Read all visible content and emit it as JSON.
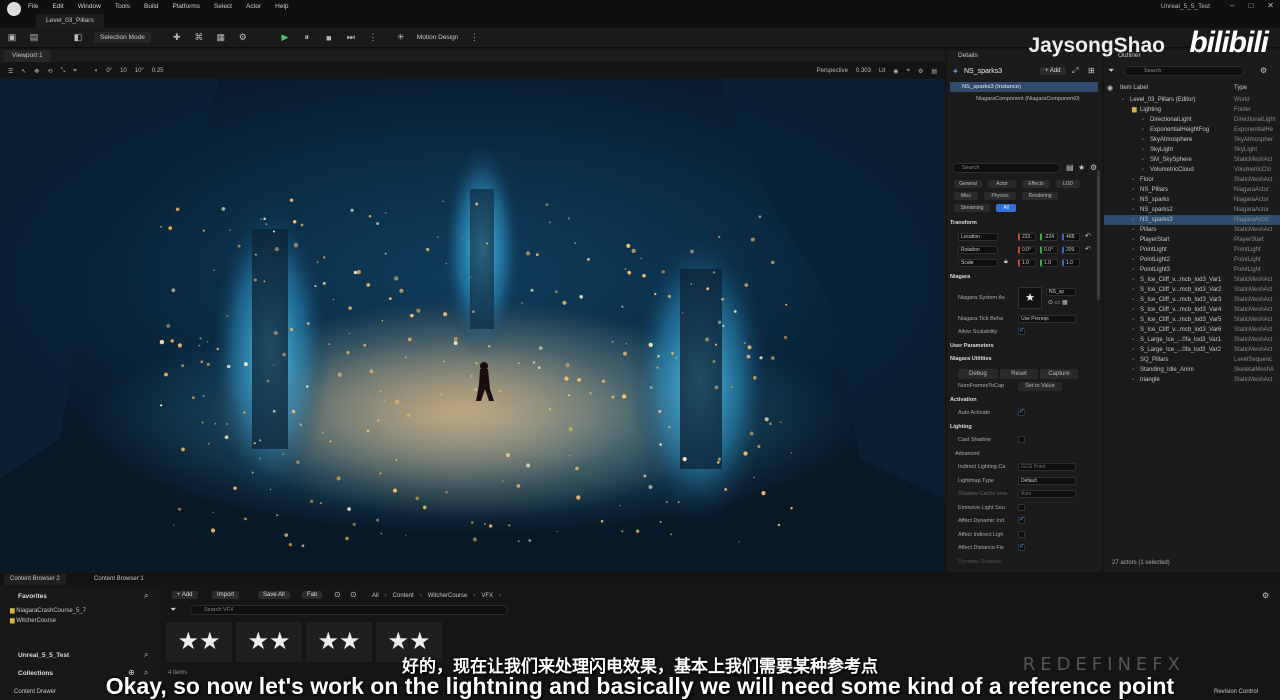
{
  "menu": [
    "File",
    "Edit",
    "Window",
    "Tools",
    "Build",
    "Platforms",
    "Select",
    "Actor",
    "Help"
  ],
  "level_tab": "Level_03_Pillars",
  "project_name": "Unreal_5_5_Test",
  "window_controls": [
    "–",
    "□",
    "✕"
  ],
  "toolbar": {
    "selection_mode": "Selection Mode",
    "motion_design": "Motion Design"
  },
  "viewport": {
    "tab": "Viewport 1",
    "toolbar_values": [
      "0°",
      "10",
      "10°",
      "0.25"
    ],
    "perspective": "Perspective",
    "speed": "0.303",
    "lit": "Lit"
  },
  "details": {
    "tab": "Details",
    "actor_name": "NS_sparks3",
    "add": "+ Add",
    "instance": "NS_sparks3 (Instance)",
    "component": "NiagaraComponent (NiagaraComponent0)",
    "search_placeholder": "Search",
    "filters": [
      "General",
      "Actor",
      "Effects",
      "LOD",
      "Misc",
      "Physics",
      "Rendering",
      "Streaming",
      "All"
    ],
    "transform": {
      "header": "Transform",
      "location_label": "Location",
      "location": [
        "222.",
        "-224",
        "468."
      ],
      "rotation_label": "Rotation",
      "rotation": [
        "0.0°",
        "0.0°",
        "209."
      ],
      "scale_label": "Scale",
      "scale": [
        "1.0",
        "1.0",
        "1.0"
      ]
    },
    "niagara": {
      "header": "Niagara",
      "system_asset_label": "Niagara System As",
      "system_asset_value": "NS_sp",
      "tick_label": "Niagara Tick Beha",
      "tick_value": "Use Prereqs",
      "scalability_label": "Allow Scalability"
    },
    "user_params": "User Parameters",
    "utilities": {
      "header": "Niagara Utilities",
      "debug": "Debug",
      "reset": "Reset",
      "capture": "Capture",
      "num_frames": "NumFramesToCap",
      "set_value": "Set to Value"
    },
    "activation": {
      "header": "Activation",
      "auto_activate": "Auto Activate"
    },
    "lighting": {
      "header": "Lighting",
      "cast_shadow": "Cast Shadow",
      "advanced": "Advanced",
      "indirect_label": "Indirect Lighting Ca",
      "indirect_value": "GCG Point",
      "lightmap_label": "Lightmap Type",
      "lightmap_value": "Default",
      "shadow_label": "Shadow Cache Inva",
      "shadow_value": "Auto",
      "emissive": "Emissive Light Sou",
      "affect_dynamic": "Affect Dynamic Ind",
      "affect_indirect": "Affect Indirect Ligh",
      "affect_distance": "Affect Distance Fie",
      "dynamic_shadow": "Dynamic Shadow"
    }
  },
  "outliner": {
    "tab": "Outliner",
    "search_placeholder": "Search",
    "col_label": "Item Label",
    "col_type": "Type",
    "items": [
      {
        "label": "Level_03_Pillars (Editor)",
        "type": "World",
        "indent": 0
      },
      {
        "label": "Lighting",
        "type": "Folder",
        "indent": 1
      },
      {
        "label": "DirectionalLight",
        "type": "DirectionalLight",
        "indent": 2
      },
      {
        "label": "ExponentialHeightFog",
        "type": "ExponentialHe",
        "indent": 2
      },
      {
        "label": "SkyAtmosphere",
        "type": "SkyAtmospher",
        "indent": 2
      },
      {
        "label": "SkyLight",
        "type": "SkyLight",
        "indent": 2
      },
      {
        "label": "SM_SkySphere",
        "type": "StaticMeshAct",
        "indent": 2
      },
      {
        "label": "VolumetricCloud",
        "type": "VolumetricClo",
        "indent": 2
      },
      {
        "label": "Floor",
        "type": "StaticMeshAct",
        "indent": 1
      },
      {
        "label": "NS_Pillars",
        "type": "NiagaraActor",
        "indent": 1
      },
      {
        "label": "NS_sparks",
        "type": "NiagaraActor",
        "indent": 1
      },
      {
        "label": "NS_sparks2",
        "type": "NiagaraActor",
        "indent": 1
      },
      {
        "label": "NS_sparks3",
        "type": "NiagaraActor",
        "indent": 1,
        "selected": true
      },
      {
        "label": "Pillars",
        "type": "StaticMeshAct",
        "indent": 1
      },
      {
        "label": "PlayerStart",
        "type": "PlayerStart",
        "indent": 1
      },
      {
        "label": "PointLight",
        "type": "PointLight",
        "indent": 1
      },
      {
        "label": "PointLight2",
        "type": "PointLight",
        "indent": 1
      },
      {
        "label": "PointLight3",
        "type": "PointLight",
        "indent": 1
      },
      {
        "label": "S_Ice_Cliff_v...mcb_lod3_Var1",
        "type": "StaticMeshAct",
        "indent": 1
      },
      {
        "label": "S_Ice_Cliff_v...mcb_lod3_Var2",
        "type": "StaticMeshAct",
        "indent": 1
      },
      {
        "label": "S_Ice_Cliff_v...mcb_lod3_Var3",
        "type": "StaticMeshAct",
        "indent": 1
      },
      {
        "label": "S_Ice_Cliff_v...mcb_lod3_Var4",
        "type": "StaticMeshAct",
        "indent": 1
      },
      {
        "label": "S_Ice_Cliff_v...mcb_lod3_Var5",
        "type": "StaticMeshAct",
        "indent": 1
      },
      {
        "label": "S_Ice_Cliff_v...mcb_lod3_Var6",
        "type": "StaticMeshAct",
        "indent": 1
      },
      {
        "label": "S_Large_Ice_...0fa_lod3_Var1",
        "type": "StaticMeshAct",
        "indent": 1
      },
      {
        "label": "S_Large_Ice_...0fa_lod3_Var2",
        "type": "StaticMeshAct",
        "indent": 1
      },
      {
        "label": "SQ_Pillars",
        "type": "LevelSequenc",
        "indent": 1
      },
      {
        "label": "Standing_Idle_Anim",
        "type": "SkeletalMeshA",
        "indent": 1
      },
      {
        "label": "triangle",
        "type": "StaticMeshAct",
        "indent": 1
      }
    ],
    "footer": "27 actors (1 selected)"
  },
  "content_browser": {
    "tabs": [
      "Content Browser 2",
      "Content Browser 1"
    ],
    "add": "+ Add",
    "import": "Import",
    "save_all": "Save All",
    "fab": "Fab",
    "path": [
      "All",
      "Content",
      "WitcherCourse",
      "VFX"
    ],
    "search_placeholder": "Search VFX",
    "favorites": "Favorites",
    "favorite_items": [
      "NiagaraCrashCourse_5_7",
      "WitcherCourse"
    ],
    "project_root": "Unreal_5_5_Test",
    "collections": "Collections",
    "item_count": "4 items",
    "content_drawer": "Content Drawer",
    "revision_control": "Revision Control"
  },
  "overlay": {
    "watermark": "JaysongShao",
    "bili": "bilibili",
    "redefine": "REDEFINEFX",
    "subtitle_cn": "好的，现在让我们来处理闪电效果，基本上我们需要某种参考点",
    "subtitle_en": "Okay, so now let's work on the lightning and basically we will need some kind of a reference point"
  },
  "colors": {
    "accent": "#2f6fd6",
    "selection": "#2f4b6d",
    "bg": "#151515",
    "panel": "#1b1b1b"
  }
}
